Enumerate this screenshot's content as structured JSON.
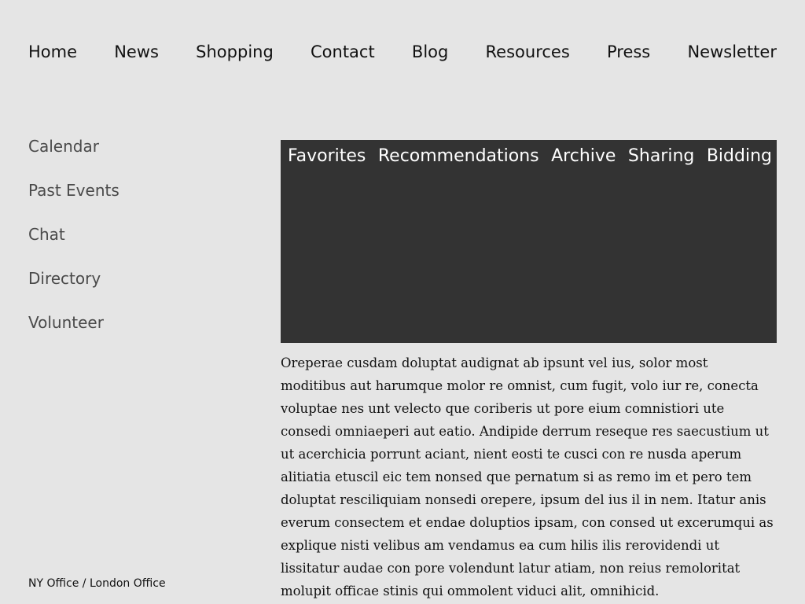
{
  "top_nav": {
    "items": [
      {
        "label": "Home"
      },
      {
        "label": "News"
      },
      {
        "label": "Shopping"
      },
      {
        "label": "Contact"
      },
      {
        "label": "Blog"
      },
      {
        "label": "Resources"
      },
      {
        "label": "Press"
      },
      {
        "label": "Newsletter"
      }
    ]
  },
  "side_nav": {
    "items": [
      {
        "label": "Calendar"
      },
      {
        "label": "Past Events"
      },
      {
        "label": "Chat"
      },
      {
        "label": "Directory"
      },
      {
        "label": "Volunteer"
      }
    ]
  },
  "tab_panel": {
    "tabs": [
      {
        "label": "Favorites"
      },
      {
        "label": "Recommendations"
      },
      {
        "label": "Archive"
      },
      {
        "label": "Sharing"
      },
      {
        "label": "Bidding"
      }
    ]
  },
  "main": {
    "paragraph": "Oreperae cusdam doluptat audignat ab ipsunt vel ius, solor most moditibus aut harumque molor re omnist, cum fugit, volo iur re, conecta voluptae nes unt velecto que coriberis ut pore eium comnistiori ute consedi omniaeperi aut eatio. Andipide derrum reseque res saecustium ut ut acerchicia porrunt aciant, nient eosti te cusci con re nusda aperum alitiatia etuscil eic tem nonsed que pernatum si as remo im et pero tem doluptat resciliquiam nonsedi orepere, ipsum del ius il in nem. Itatur anis everum consectem et endae doluptios ipsam, con consed ut excerumqui as explique nisti velibus am vendamus ea cum hilis ilis rerovidendi ut lissitatur audae con pore volendunt latur atiam, non reius remoloritat molupit officae stinis qui ommolent viduci alit, omnihicid."
  },
  "footer": {
    "text": "NY Office / London Office"
  },
  "colors": {
    "background": "#e5e5e5",
    "panel": "#333333",
    "panel_text": "#ffffff",
    "side_nav_text": "#4a4a4a"
  }
}
